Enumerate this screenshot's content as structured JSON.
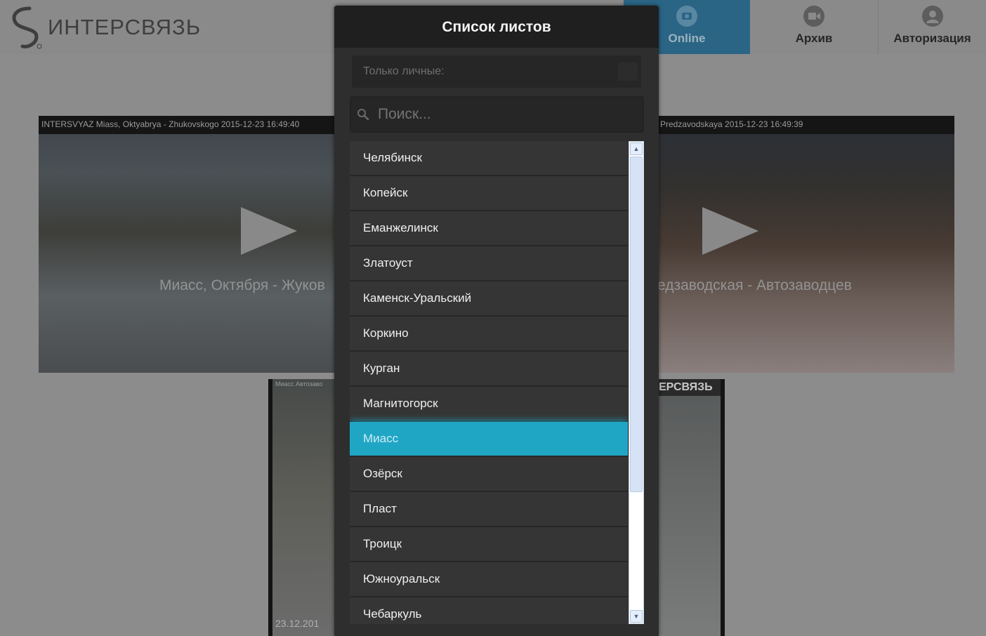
{
  "header": {
    "logo_text": "ИНТЕРСВЯЗЬ",
    "nav": [
      {
        "label": "Online",
        "icon": "camera-icon",
        "active": true
      },
      {
        "label": "Архив",
        "icon": "video-camera-icon"
      },
      {
        "label": "Авторизация",
        "icon": "user-icon"
      }
    ]
  },
  "tiles": [
    {
      "caption": "INTERSVYAZ Miass, Oktyabrya - Zhukovskogo 2015-12-23 16:49:40",
      "label": "Миасс, Октября - Жуков"
    },
    {
      "caption": "Predzavodskaya 2015-12-23 16:49:39",
      "label": "едзаводская - Автозаводцев"
    },
    {
      "caption": "Миасс Автозаво",
      "timestamp": "23.12.201"
    },
    {
      "caption": "ЕРСВЯЗЬ"
    }
  ],
  "modal": {
    "title": "Список листов",
    "filter_label": "Только личные:",
    "search_placeholder": "Поиск...",
    "items": [
      "Челябинск",
      "Копейск",
      "Еманжелинск",
      "Златоуст",
      "Каменск-Уральский",
      "Коркино",
      "Курган",
      "Магнитогорск",
      "Миасс",
      "Озёрск",
      "Пласт",
      "Троицк",
      "Южноуральск",
      "Чебаркуль"
    ],
    "selected": "Миасс"
  },
  "colors": {
    "accent": "#20a6c5",
    "nav_active": "#2b6586",
    "modal_bg": "#2e2e2e"
  }
}
